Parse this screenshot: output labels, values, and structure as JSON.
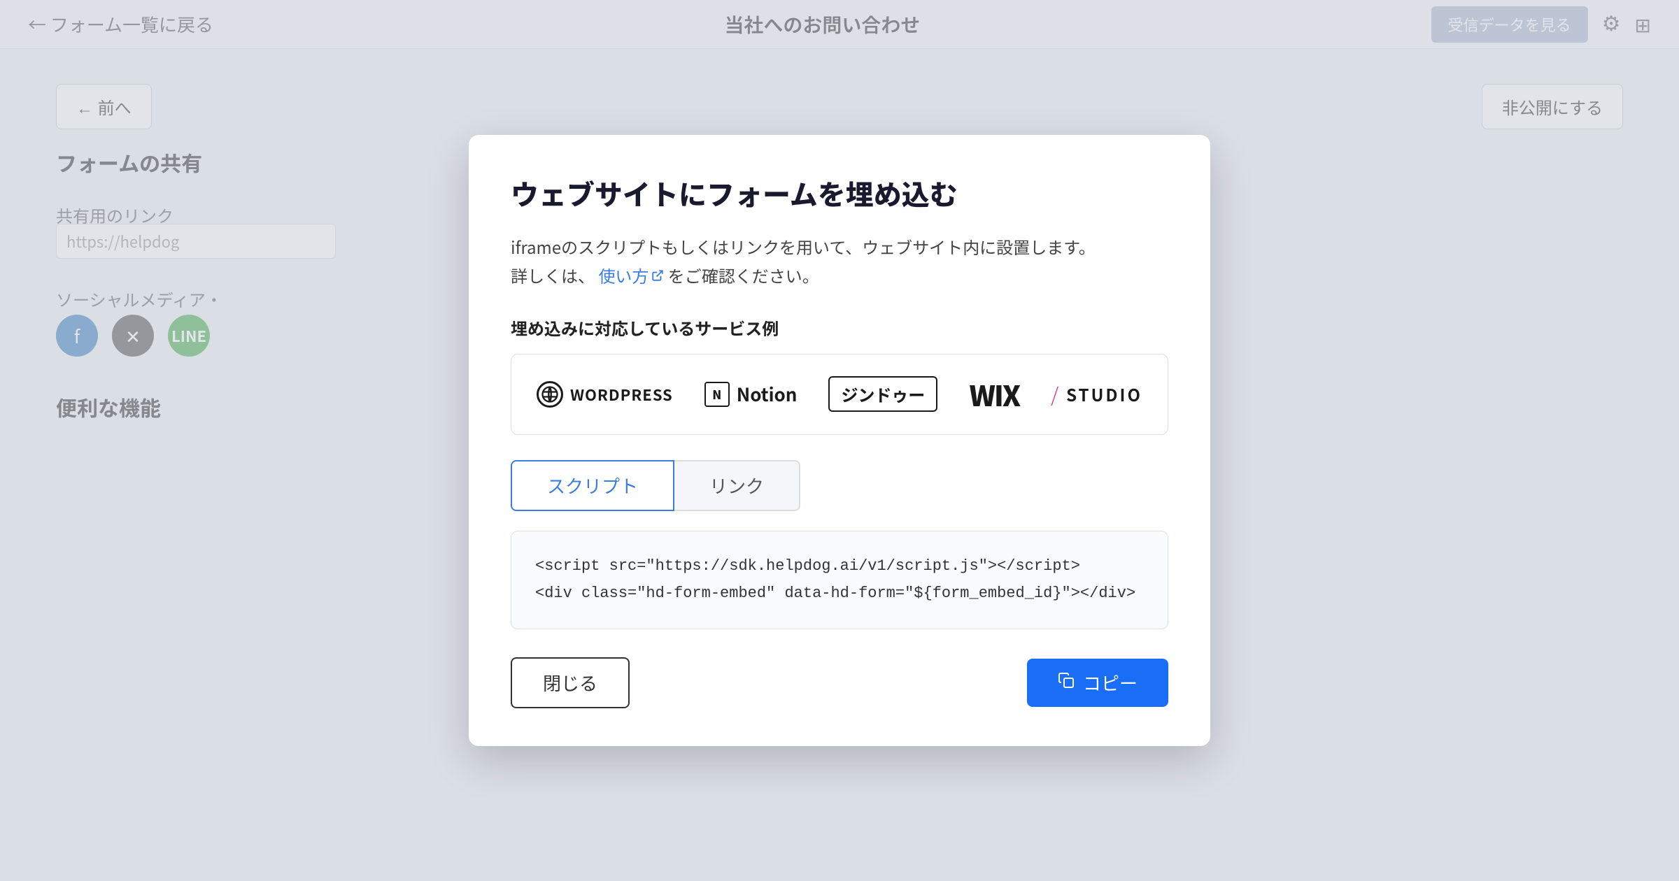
{
  "header": {
    "back_label": "← フォーム一覧に戻る",
    "title": "当社へのお問い合わせ",
    "data_button_label": "受信データを見る",
    "gear_icon": "⚙",
    "expand_icon": "⊞"
  },
  "content": {
    "prev_button": "← 前へ",
    "next_button": "非公開にする",
    "section_title": "フォームの共有",
    "share_link_label": "共有用のリンク",
    "share_link_value": "https://helpdog",
    "social_label": "ソーシャルメディア・",
    "useful_label": "便利な機能"
  },
  "modal": {
    "title": "ウェブサイトにフォームを埋め込む",
    "description_line1": "iframeのスクリプトもしくはリンクを用いて、ウェブサイト内に設置します。",
    "description_line2_pre": "詳しくは、",
    "description_link": "使い方",
    "description_line2_post": "をご確認ください。",
    "services_section_label": "埋め込みに対応しているサービス例",
    "services": [
      {
        "id": "wordpress",
        "name": "WORDPRESS"
      },
      {
        "id": "notion",
        "name": "Notion"
      },
      {
        "id": "jimdo",
        "name": "ジンドゥー"
      },
      {
        "id": "wix",
        "name": "WIX"
      },
      {
        "id": "studio",
        "name": "STUDIO"
      }
    ],
    "tab_script": "スクリプト",
    "tab_link": "リンク",
    "code_line1": "<script src=\"https://sdk.helpdog.ai/v1/script.js\"></script>",
    "code_line2": "<div class=\"hd-form-embed\" data-hd-form=\"${form_embed_id}\"></div>",
    "close_button": "閉じる",
    "copy_button": "コピー",
    "copy_icon": "🗐"
  }
}
